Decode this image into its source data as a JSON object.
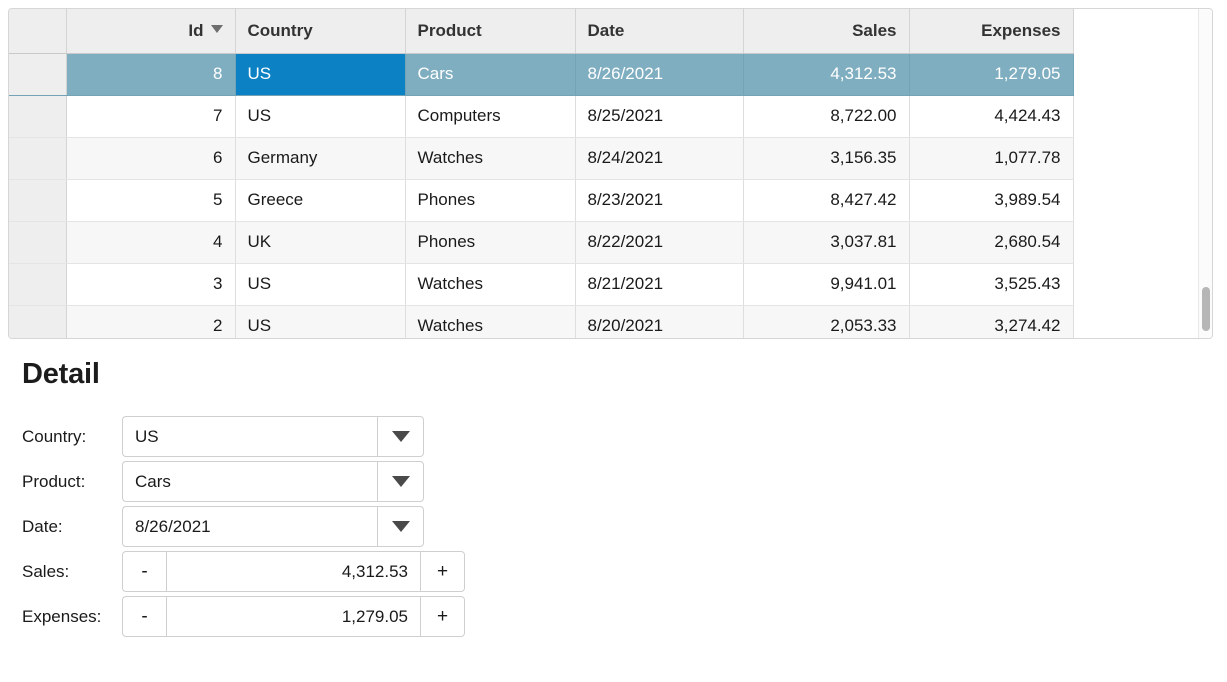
{
  "grid": {
    "columns": [
      {
        "key": "gutter",
        "label": "",
        "align": "left",
        "sorted": false
      },
      {
        "key": "id",
        "label": "Id",
        "align": "right",
        "sorted": true,
        "sort_dir": "desc",
        "sort_icon": "caret-down-icon"
      },
      {
        "key": "country",
        "label": "Country",
        "align": "left",
        "sorted": false
      },
      {
        "key": "product",
        "label": "Product",
        "align": "left",
        "sorted": false
      },
      {
        "key": "date",
        "label": "Date",
        "align": "left",
        "sorted": false
      },
      {
        "key": "sales",
        "label": "Sales",
        "align": "right",
        "sorted": false
      },
      {
        "key": "expenses",
        "label": "Expenses",
        "align": "right",
        "sorted": false
      }
    ],
    "rows": [
      {
        "id": "8",
        "country": "US",
        "product": "Cars",
        "date": "8/26/2021",
        "sales": "4,312.53",
        "expenses": "1,279.05",
        "selected": true,
        "focused_column": "country"
      },
      {
        "id": "7",
        "country": "US",
        "product": "Computers",
        "date": "8/25/2021",
        "sales": "8,722.00",
        "expenses": "4,424.43",
        "selected": false
      },
      {
        "id": "6",
        "country": "Germany",
        "product": "Watches",
        "date": "8/24/2021",
        "sales": "3,156.35",
        "expenses": "1,077.78",
        "selected": false
      },
      {
        "id": "5",
        "country": "Greece",
        "product": "Phones",
        "date": "8/23/2021",
        "sales": "8,427.42",
        "expenses": "3,989.54",
        "selected": false
      },
      {
        "id": "4",
        "country": "UK",
        "product": "Phones",
        "date": "8/22/2021",
        "sales": "3,037.81",
        "expenses": "2,680.54",
        "selected": false
      },
      {
        "id": "3",
        "country": "US",
        "product": "Watches",
        "date": "8/21/2021",
        "sales": "9,941.01",
        "expenses": "3,525.43",
        "selected": false
      },
      {
        "id": "2",
        "country": "US",
        "product": "Watches",
        "date": "8/20/2021",
        "sales": "2,053.33",
        "expenses": "3,274.42",
        "selected": false
      }
    ],
    "scrollbar": {
      "orientation": "vertical",
      "thumb_position": "near-bottom"
    },
    "colors": {
      "header_background": "#eeeeee",
      "row_selected": "#80aec1",
      "cell_focused": "#0c82c4",
      "row_stripe": "#f7f7f7",
      "grid_border": "#d6d6d6"
    }
  },
  "detail": {
    "title": "Detail",
    "fields": [
      {
        "type": "combo",
        "label": "Country:",
        "value": "US",
        "arrow_icon": "caret-down-icon"
      },
      {
        "type": "combo",
        "label": "Product:",
        "value": "Cars",
        "arrow_icon": "caret-down-icon"
      },
      {
        "type": "combo",
        "label": "Date:",
        "value": "8/26/2021",
        "arrow_icon": "caret-down-icon"
      },
      {
        "type": "spinner",
        "label": "Sales:",
        "value": "4,312.53",
        "minus_label": "-",
        "plus_label": "+"
      },
      {
        "type": "spinner",
        "label": "Expenses:",
        "value": "1,279.05",
        "minus_label": "-",
        "plus_label": "+"
      }
    ]
  }
}
